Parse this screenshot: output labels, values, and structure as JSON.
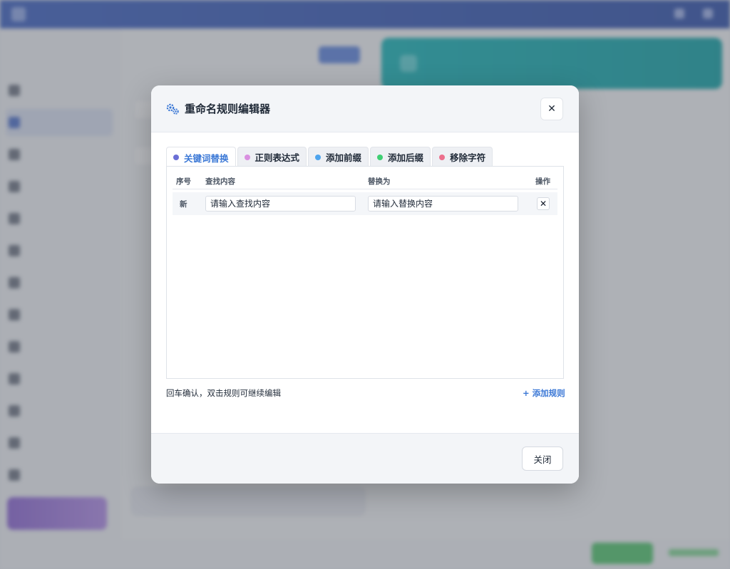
{
  "modal": {
    "title": "重命名规则编辑器",
    "header_icon": "gears-icon",
    "close_icon": "close-icon",
    "close_symbol": "✕",
    "tabs": [
      {
        "label": "关键词替换",
        "dot_color": "#6b6fd6",
        "active": true
      },
      {
        "label": "正则表达式",
        "dot_color": "#d98fe0",
        "active": false
      },
      {
        "label": "添加前缀",
        "dot_color": "#4ea4ee",
        "active": false
      },
      {
        "label": "添加后缀",
        "dot_color": "#3fcf73",
        "active": false
      },
      {
        "label": "移除字符",
        "dot_color": "#ec6f8c",
        "active": false
      }
    ],
    "table": {
      "headers": {
        "index": "序号",
        "find": "查找内容",
        "replace": "替换为",
        "action": "操作"
      },
      "new_row": {
        "index": "新",
        "find_placeholder": "请输入查找内容",
        "replace_placeholder": "请输入替换内容",
        "delete_symbol": "✕"
      }
    },
    "hint": "回车确认，双击规则可继续编辑",
    "add_rule_label": "+ 添加规则",
    "footer": {
      "close_label": "关闭"
    }
  },
  "colors": {
    "accent": "#3b78d6",
    "topbar": "#3b5fc0",
    "teal_card": "#13b3b6",
    "promo": "#8a63d2",
    "green_button": "#4fc36a"
  }
}
